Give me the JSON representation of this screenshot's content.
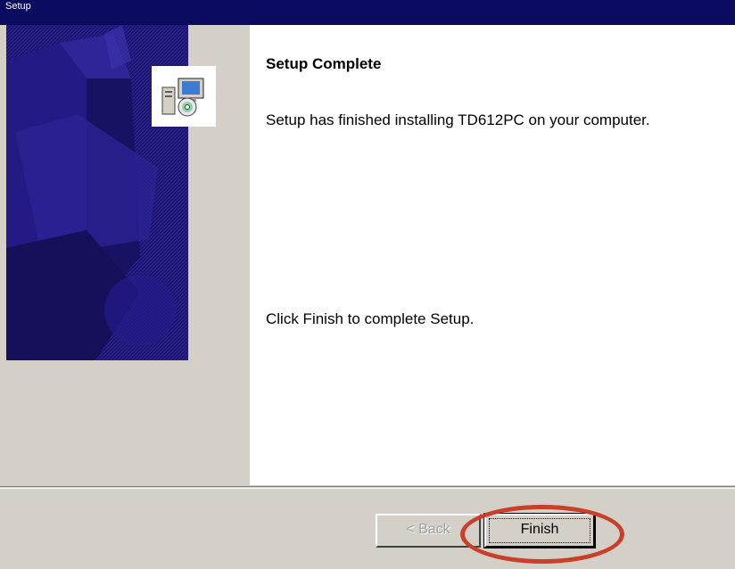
{
  "window": {
    "title": "Setup"
  },
  "content": {
    "heading": "Setup Complete",
    "message": "Setup has finished installing TD612PC on your computer.",
    "instruction": "Click Finish to complete Setup."
  },
  "buttons": {
    "back_label": "< Back",
    "finish_label": "Finish"
  },
  "icons": {
    "setup": "setup-computer-cd-icon",
    "graphic": "installer-side-graphic"
  },
  "colors": {
    "titlebar": "#0a0a5e",
    "panel": "#1b1470",
    "highlight": "#c8402a"
  }
}
